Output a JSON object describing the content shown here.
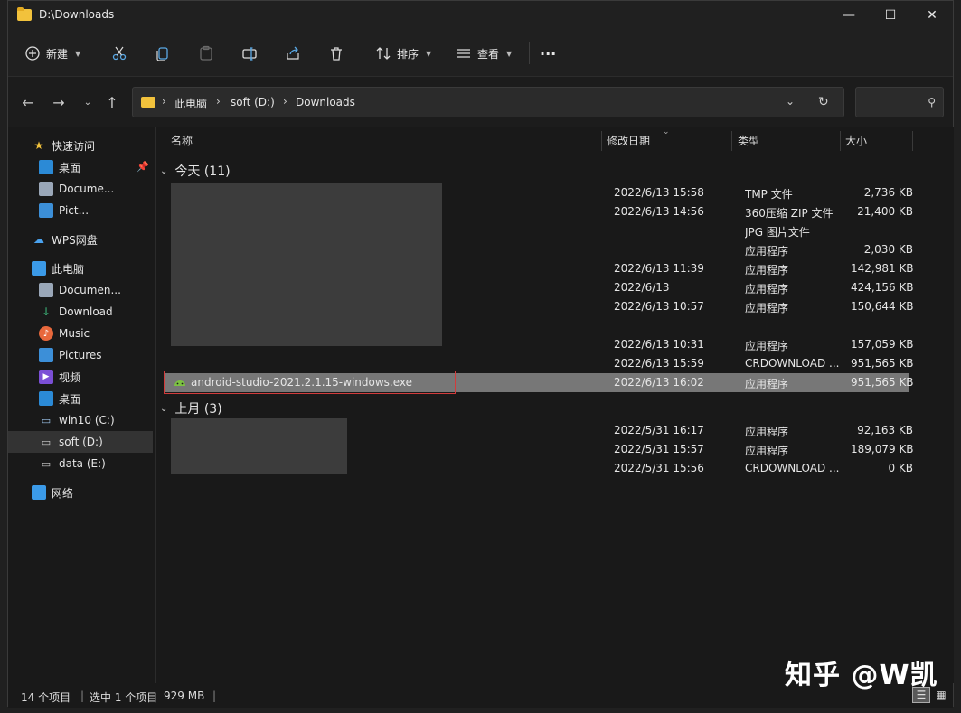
{
  "window": {
    "title": "D:\\Downloads"
  },
  "window_controls": {
    "minimize": "—",
    "maximize": "☐",
    "close": "✕"
  },
  "toolbar": {
    "new_label": "新建",
    "sort_label": "排序",
    "view_label": "查看",
    "more_label": "···"
  },
  "address": {
    "crumbs": [
      "此电脑",
      "soft (D:)",
      "Downloads"
    ]
  },
  "search": {
    "placeholder": ""
  },
  "nav": {
    "quick_access": "快速访问",
    "items_quick": [
      "桌面",
      "Docume...",
      "Pict..."
    ],
    "wps": "WPS网盘",
    "this_pc": "此电脑",
    "items_pc": [
      "Documen...",
      "Download",
      "Music",
      "Pictures",
      "视频",
      "桌面",
      "win10 (C:)",
      "soft (D:)",
      "data (E:)"
    ],
    "network": "网络"
  },
  "columns": {
    "name": "名称",
    "date": "修改日期",
    "type": "类型",
    "size": "大小"
  },
  "groups": {
    "today": "今天 (11)",
    "last_month": "上月 (3)"
  },
  "files_today": [
    {
      "name": "",
      "date": "2022/6/13 15:58",
      "type": "TMP 文件",
      "size": "2,736 KB"
    },
    {
      "name": "",
      "date": "2022/6/13 14:56",
      "type": "360压缩 ZIP 文件",
      "size": "21,400 KB"
    },
    {
      "name": "",
      "date": "",
      "type": "JPG 图片文件",
      "size": ""
    },
    {
      "name": "",
      "date": "",
      "type": "应用程序",
      "size": "2,030 KB"
    },
    {
      "name": "",
      "date": "2022/6/13 11:39",
      "type": "应用程序",
      "size": "142,981 KB"
    },
    {
      "name": "",
      "date": "2022/6/13",
      "type": "应用程序",
      "size": "424,156 KB"
    },
    {
      "name": "",
      "date": "2022/6/13 10:57",
      "type": "应用程序",
      "size": "150,644 KB"
    },
    {
      "name": "",
      "date": "",
      "type": "",
      "size": ""
    },
    {
      "name": "",
      "date": "2022/6/13 10:31",
      "type": "应用程序",
      "size": "157,059 KB"
    },
    {
      "name": "",
      "date": "2022/6/13 15:59",
      "type": "CRDOWNLOAD ...",
      "size": "951,565 KB"
    },
    {
      "name": "android-studio-2021.2.1.15-windows.exe",
      "date": "2022/6/13 16:02",
      "type": "应用程序",
      "size": "951,565 KB"
    }
  ],
  "files_last_month": [
    {
      "name": "",
      "date": "2022/5/31 16:17",
      "type": "应用程序",
      "size": "92,163 KB"
    },
    {
      "name": "",
      "date": "2022/5/31 15:57",
      "type": "应用程序",
      "size": "189,079 KB"
    },
    {
      "name": "",
      "date": "2022/5/31 15:56",
      "type": "CRDOWNLOAD ...",
      "size": "0 KB"
    }
  ],
  "status": {
    "count": "14 个项目",
    "selected": "选中 1 个项目",
    "size": "929 MB"
  },
  "watermark": "知乎 @W凯"
}
